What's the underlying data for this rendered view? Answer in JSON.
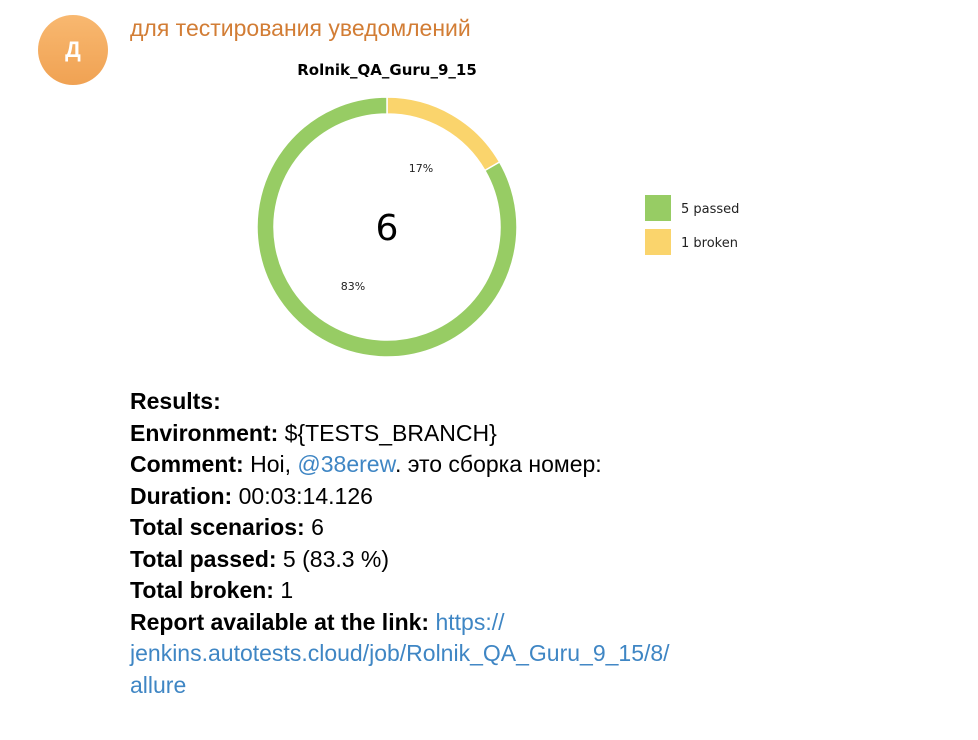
{
  "message": {
    "avatar_letter": "Д",
    "avatar_color": "#f0a253",
    "sender_name": "для тестирования уведомлений",
    "sender_color": "#d27d35"
  },
  "chart_data": {
    "type": "pie",
    "donut": true,
    "title": "Rolnik_QA_Guru_9_15",
    "center_label": "6",
    "categories": [
      "passed",
      "broken"
    ],
    "values": [
      5,
      1
    ],
    "slice_labels": [
      "83%",
      "17%"
    ],
    "legend": [
      "5 passed",
      "1 broken"
    ],
    "legend_placement": "right",
    "colors": [
      "#97cc64",
      "#fad46c"
    ]
  },
  "results": {
    "heading": "Results:",
    "environment_label": "Environment:",
    "environment_value": " ${TESTS_BRANCH}",
    "comment_label": "Comment:",
    "comment_prefix": " Hoi, ",
    "comment_mention": "@38erew",
    "comment_suffix": ". это сборка номер:",
    "duration_label": "Duration:",
    "duration_value": " 00:03:14.126",
    "total_scenarios_label": "Total scenarios:",
    "total_scenarios_value": " 6",
    "total_passed_label": "Total passed:",
    "total_passed_value": " 5 (83.3 %)",
    "total_broken_label": "Total broken:",
    "total_broken_value": " 1",
    "report_label": "Report available at the link:",
    "report_url_part1": " https://",
    "report_url_part2": "jenkins.autotests.cloud/job/Rolnik_QA_Guru_9_15/8/",
    "report_url_part3": "allure",
    "link_color": "#3f86c4"
  }
}
